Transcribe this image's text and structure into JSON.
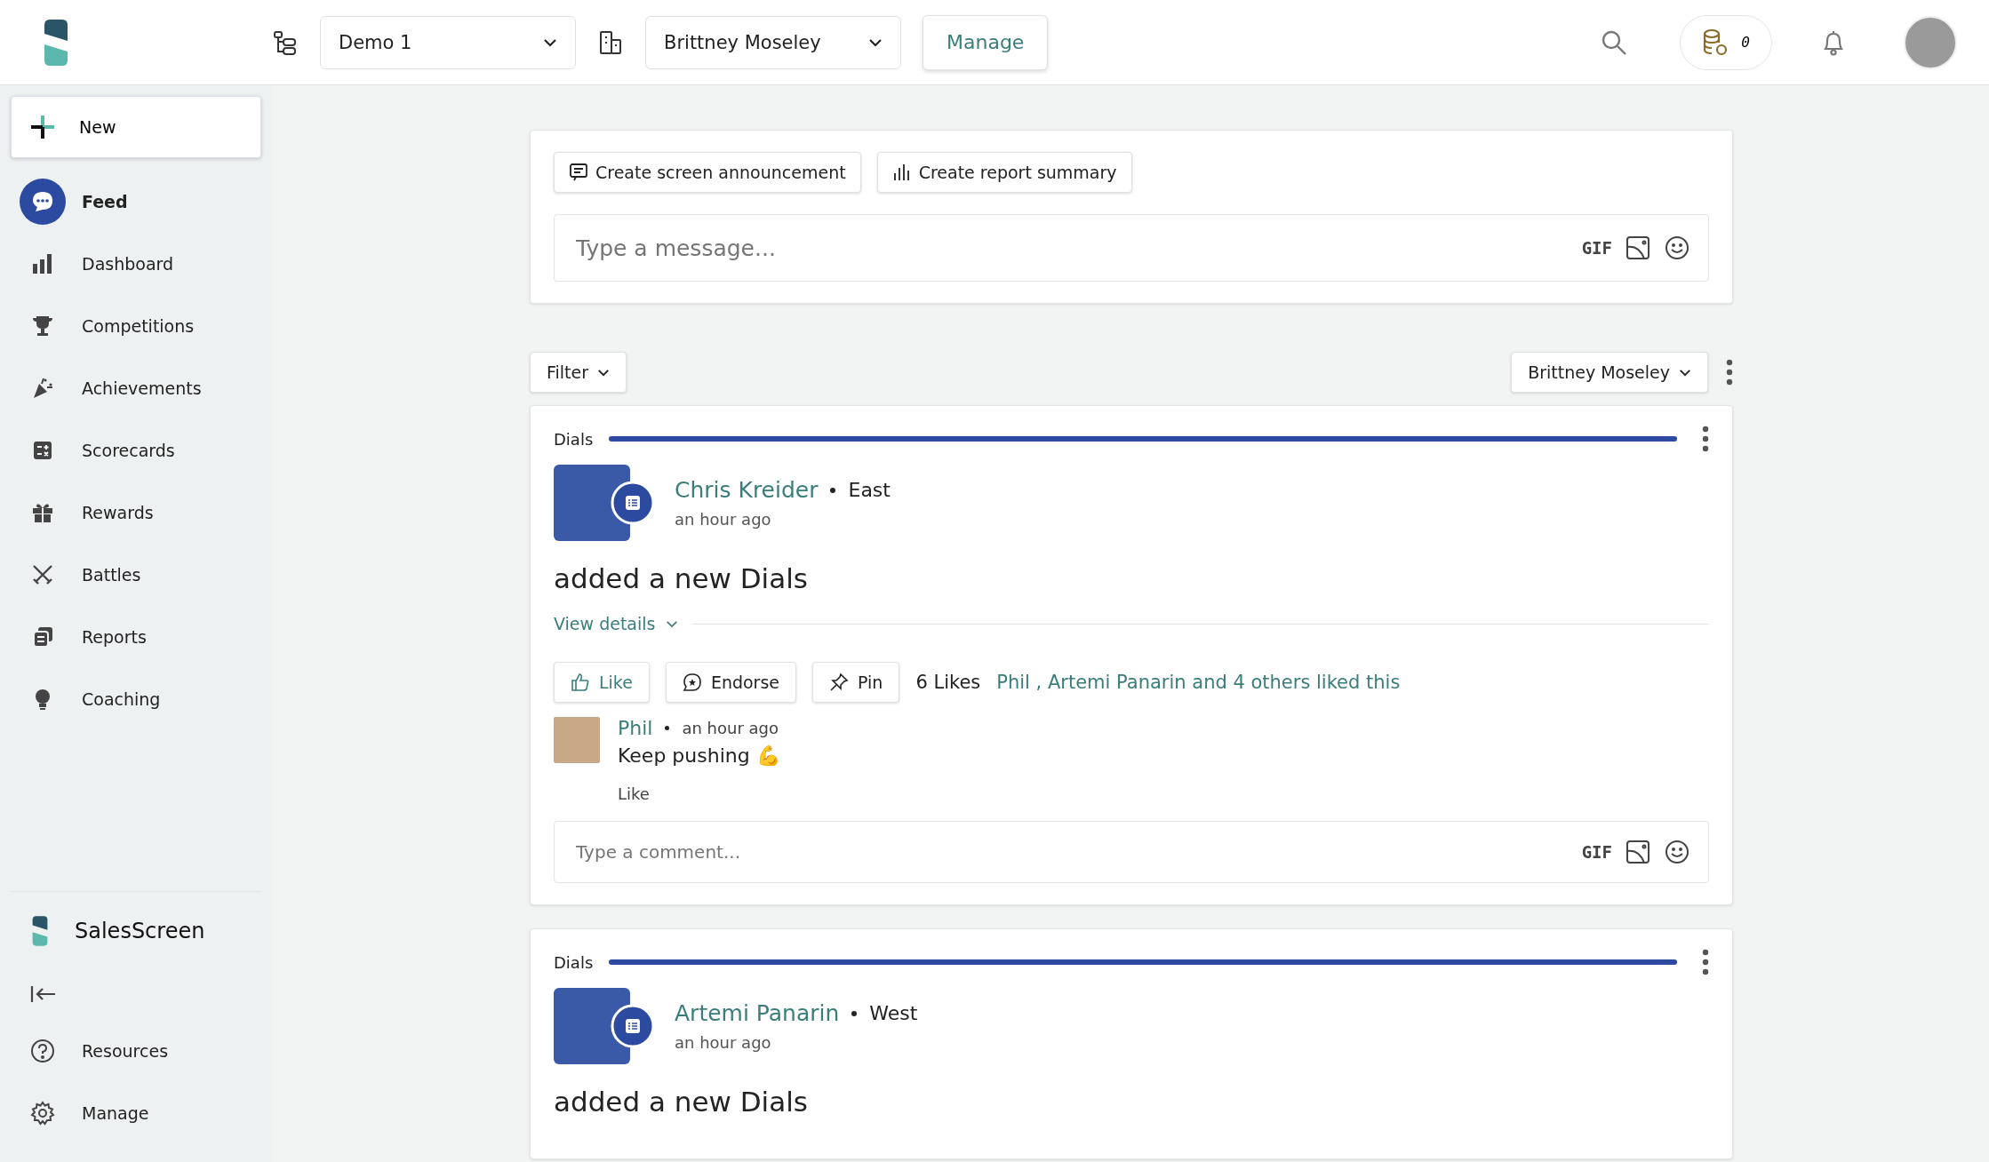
{
  "topbar": {
    "org_select": "Demo 1",
    "user_select": "Brittney Moseley",
    "manage_button": "Manage",
    "coins": "0"
  },
  "sidebar": {
    "new_button": "New",
    "items": [
      {
        "label": "Feed",
        "selected": true
      },
      {
        "label": "Dashboard",
        "selected": false
      },
      {
        "label": "Competitions",
        "selected": false
      },
      {
        "label": "Achievements",
        "selected": false
      },
      {
        "label": "Scorecards",
        "selected": false
      },
      {
        "label": "Rewards",
        "selected": false
      },
      {
        "label": "Battles",
        "selected": false
      },
      {
        "label": "Reports",
        "selected": false
      },
      {
        "label": "Coaching",
        "selected": false
      }
    ],
    "brand": "SalesScreen",
    "bottom_items": [
      {
        "label": "Resources"
      },
      {
        "label": "Manage"
      }
    ]
  },
  "composer": {
    "actions": [
      "Create screen announcement",
      "Create report summary"
    ],
    "placeholder": "Type a message...",
    "gif": "GIF"
  },
  "filter_bar": {
    "filter": "Filter",
    "user": "Brittney Moseley"
  },
  "posts": [
    {
      "metric": "Dials",
      "level": 1,
      "author": "Chris Kreider",
      "team": "East",
      "time": "an hour ago",
      "text": "added a new Dials",
      "view_details": "View details",
      "actions": [
        "Like",
        "Endorse",
        "Pin"
      ],
      "likes": "6 Likes",
      "liked_by": "Phil , Artemi Panarin and 4 others liked this",
      "comments": [
        {
          "author": "Phil",
          "time": "an hour ago",
          "text": "Keep pushing 💪",
          "like": "Like"
        }
      ],
      "comment_placeholder": "Type a comment...",
      "gif": "GIF"
    },
    {
      "metric": "Dials",
      "level": 1,
      "author": "Artemi Panarin",
      "team": "West",
      "time": "an hour ago",
      "text": "added a new Dials"
    }
  ]
}
